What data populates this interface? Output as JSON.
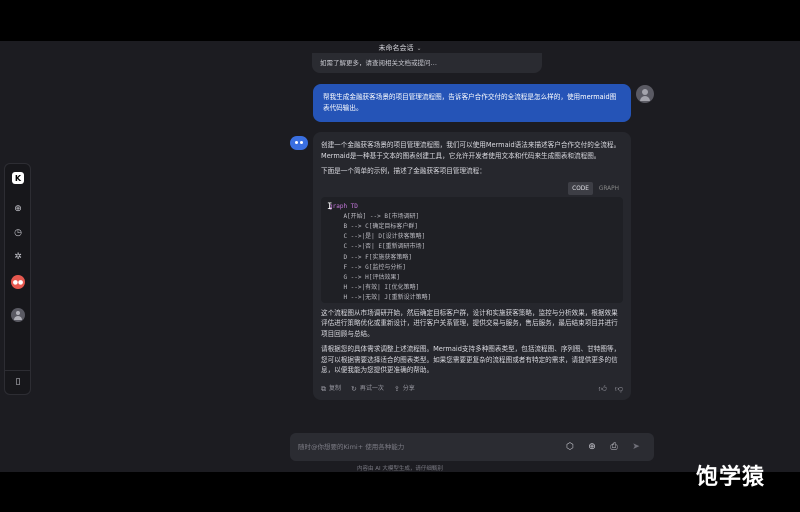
{
  "conversation": {
    "title": "未命名会话"
  },
  "messages": {
    "prev_snippet": "如需了解更多，请查阅相关文档或提问…",
    "user_text": "帮我生成金融获客场景的项目管理流程图，告诉客户合作交付的全流程是怎么样的，使用mermaid图表代码输出。",
    "bot": {
      "intro": "创建一个金融获客场景的项目管理流程图，我们可以使用Mermaid语法来描述客户合作交付的全流程。Mermaid是一种基于文本的图表创建工具，它允许开发者使用文本和代码来生成图表和流程图。",
      "lead": "下面是一个简单的示例，描述了金融获客项目管理流程：",
      "code_tabs": [
        "CODE",
        "GRAPH"
      ],
      "code_lines": [
        "graph TD",
        "    A[开始] --> B[市场调研]",
        "    B --> C[确定目标客户群]",
        "    C -->|是| D[设计获客策略]",
        "    C -->|否| E[重新调研市场]",
        "    D --> F[实施获客策略]",
        "    F --> G[监控与分析]",
        "    G --> H[评估效果]",
        "    H -->|有效| I[优化策略]",
        "    H -->|无效| J[重新设计策略]"
      ],
      "summary": "这个流程图从市场调研开始，然后确定目标客户群，设计和实施获客策略，监控与分析效果，根据效果评估进行策略优化或重新设计，进行客户关系管理，提供交易与服务，售后服务，最后结束项目并进行项目回顾与总结。",
      "closing": "请根据您的具体需求调整上述流程图。Mermaid支持多种图表类型，包括流程图、序列图、甘特图等，您可以根据需要选择适合的图表类型。如果您需要更复杂的流程图或者有特定的需求，请提供更多的信息，以便我能为您提供更准确的帮助。",
      "actions": {
        "copy": "复制",
        "retry": "再试一次",
        "share": "分享"
      }
    }
  },
  "input": {
    "placeholder": "随时@你想要的Kimi+ 使用各种能力"
  },
  "footer": {
    "note": "内容由 AI 大模型生成，请仔细甄别"
  },
  "sidebar": {
    "logo": "K"
  },
  "watermark": "饱学猿",
  "colors": {
    "user_bubble": "#2554b7",
    "background": "#1c1c21",
    "bot_bubble": "#26272d"
  }
}
